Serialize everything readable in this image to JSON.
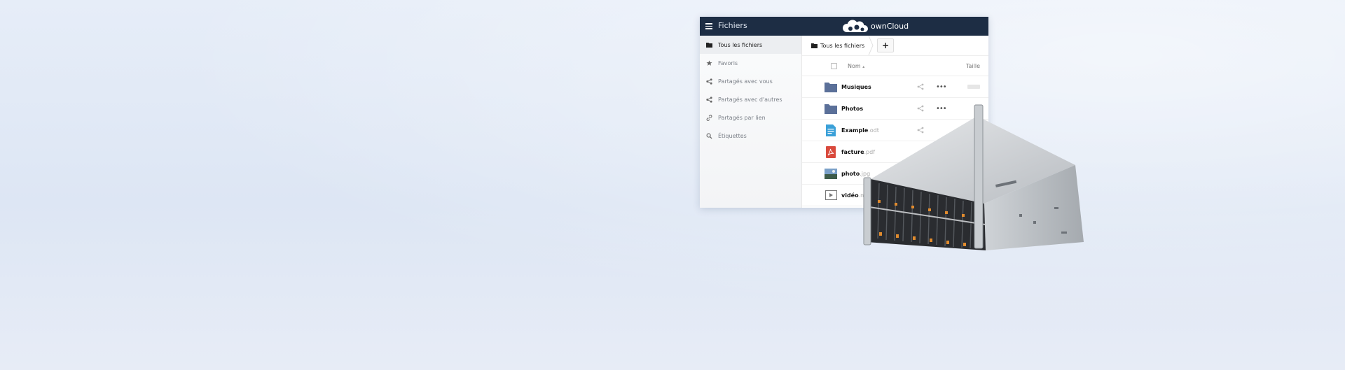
{
  "header": {
    "app_title": "Fichiers",
    "brand": "ownCloud",
    "menu_icon": "hamburger-icon",
    "logo_icon": "cloud-icon",
    "color": "#1d2d44"
  },
  "sidebar": {
    "items": [
      {
        "label": "Tous les fichiers",
        "icon": "folder-icon",
        "active": true
      },
      {
        "label": "Favoris",
        "icon": "star-icon"
      },
      {
        "label": "Partagés avec vous",
        "icon": "share-icon"
      },
      {
        "label": "Partagés avec d'autres",
        "icon": "share-icon"
      },
      {
        "label": "Partagés par lien",
        "icon": "link-icon"
      },
      {
        "label": "Étiquettes",
        "icon": "search-icon"
      }
    ]
  },
  "breadcrumb": {
    "label": "Tous les fichiers",
    "add_label": "+"
  },
  "list": {
    "columns": {
      "name": "Nom",
      "sort_indicator": "▴",
      "size": "Taille"
    },
    "rows": [
      {
        "name": "Musiques",
        "ext": "",
        "type": "folder"
      },
      {
        "name": "Photos",
        "ext": "",
        "type": "folder"
      },
      {
        "name": "Example",
        "ext": ".odt",
        "type": "document"
      },
      {
        "name": "facture",
        "ext": ".pdf",
        "type": "pdf"
      },
      {
        "name": "photo",
        "ext": ".jpg",
        "type": "image"
      },
      {
        "name": "vidéo",
        "ext": ".mp",
        "type": "video"
      }
    ]
  },
  "actions": {
    "more_label": "•••"
  },
  "colors": {
    "folder": "#5b7099",
    "document": "#3aa0d8",
    "pdf": "#d94a3d",
    "accent": "#1d2d44"
  }
}
